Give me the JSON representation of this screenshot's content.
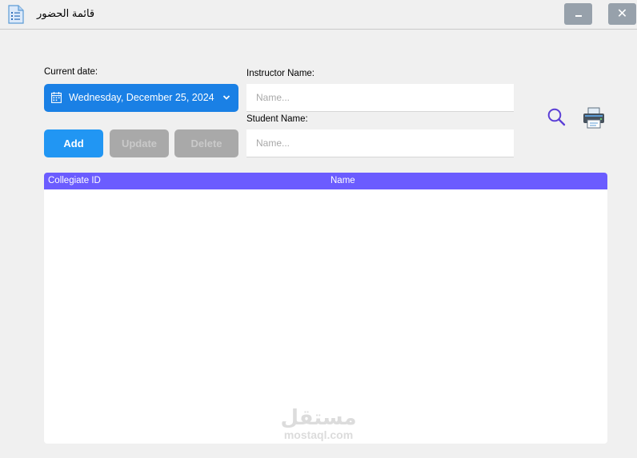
{
  "window": {
    "title": "قائمة الحضور",
    "minimize_icon": "minimize-icon",
    "close_icon": "close-icon",
    "close_glyph": "✕"
  },
  "form": {
    "current_date_label": "Current date:",
    "current_date_value": "Wednesday, December 25, 2024",
    "instructor_label": "Instructor Name:",
    "instructor_placeholder": "Name...",
    "student_label": "Student Name:",
    "student_placeholder": "Name..."
  },
  "buttons": {
    "add": "Add",
    "update": "Update",
    "delete": "Delete"
  },
  "toolbar": {
    "search_icon": "search-icon",
    "print_icon": "printer-icon"
  },
  "table": {
    "columns": [
      "Collegiate ID",
      "Name"
    ],
    "rows": []
  },
  "watermark": {
    "arabic": "مستقل",
    "latin": "mostaql.com"
  },
  "colors": {
    "accent_blue": "#2196f3",
    "date_picker_blue": "#1a80e5",
    "table_header": "#6b5cff",
    "disabled_button": "#a9a9a9",
    "window_button": "#97a1ab",
    "search_icon": "#5b3fd6"
  }
}
